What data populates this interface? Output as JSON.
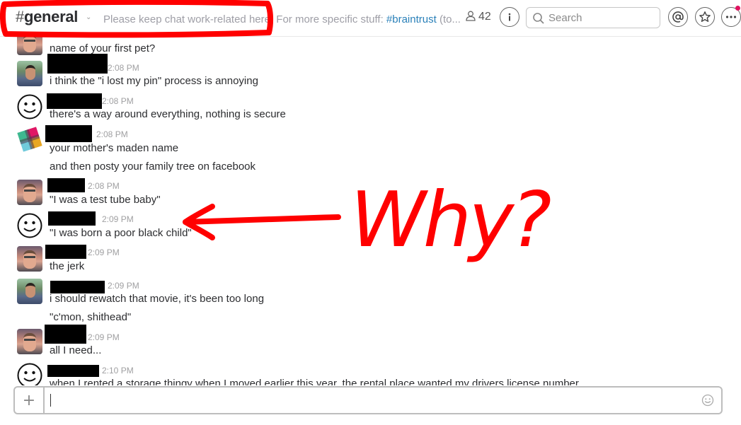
{
  "header": {
    "channel_hash": "#",
    "channel_name": "general",
    "chevron": "⌄",
    "topic_text": "Please keep chat work-related here. For more specific stuff: ",
    "topic_link": "#braintrust",
    "topic_tail": " (to...",
    "member_count": "42",
    "search_placeholder": "Search"
  },
  "messages": [
    {
      "time": "",
      "lines": [
        "name of your first pet?"
      ],
      "avatar": "person"
    },
    {
      "time": "2:08 PM",
      "lines": [
        "i think the \"i lost my pin\" process is annoying"
      ],
      "avatar": "outdoor"
    },
    {
      "time": "2:08 PM",
      "lines": [
        "there's a way around everything, nothing is secure"
      ],
      "avatar": "smiley"
    },
    {
      "time": "2:08 PM",
      "lines": [
        "your mother's maden name",
        "and then posty your family tree on facebook"
      ],
      "avatar": "slack"
    },
    {
      "time": "2:08 PM",
      "lines": [
        "\"I was a test tube baby\""
      ],
      "avatar": "person"
    },
    {
      "time": "2:09 PM",
      "lines": [
        "\"I was born a poor black child\""
      ],
      "avatar": "smiley"
    },
    {
      "time": "2:09 PM",
      "lines": [
        "the jerk"
      ],
      "avatar": "person"
    },
    {
      "time": "2:09 PM",
      "lines": [
        "i should rewatch that movie, it's been too long",
        "\"c'mon, shithead\""
      ],
      "avatar": "outdoor"
    },
    {
      "time": "2:09 PM",
      "lines": [
        "all I need..."
      ],
      "avatar": "person"
    },
    {
      "time": "2:10 PM",
      "lines": [
        "when I rented a storage thingy when I moved earlier this year, the rental place wanted my drivers license number"
      ],
      "avatar": "smiley"
    }
  ],
  "annotation": {
    "text": "Why?",
    "color": "#ff0000"
  },
  "composer": {
    "plus": "+"
  },
  "colors": {
    "link": "#2a80b9",
    "notification_dot": "#e0115f"
  }
}
